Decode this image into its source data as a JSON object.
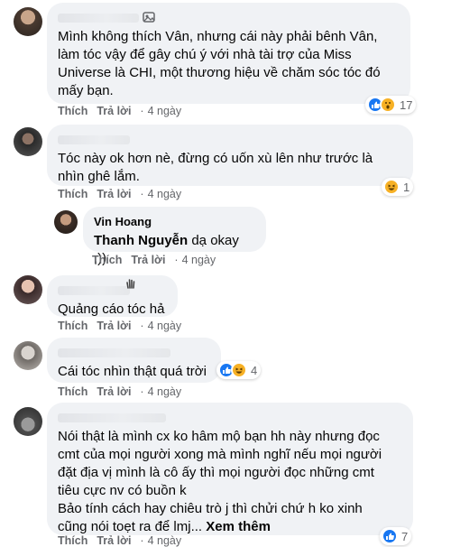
{
  "actions": {
    "like": "Thích",
    "reply": "Trả lời"
  },
  "comments": [
    {
      "text": "Mình không thích Vân, nhưng cái này phải bênh Vân,\nlàm tóc vậy để gây chú ý với nhà tài trợ của Miss\nUniverse là CHI, một thương hiệu về chăm sóc tóc đó\nmấy bạn.",
      "time": "4 ngày",
      "reaction_count": "17",
      "reactions": [
        "like-icon",
        "wow-icon"
      ]
    },
    {
      "text": "Tóc này ok hơn nè, đừng có uốn xù lên như trước là\nnhìn ghê lắm.",
      "time": "4 ngày",
      "reaction_count": "1",
      "reactions": [
        "haha-icon"
      ]
    },
    {
      "name": "Vin Hoang",
      "tag": "Thanh Nguyễn",
      "text": " dạ okay ;))",
      "time": "4 ngày"
    },
    {
      "text": "Quảng cáo tóc hả",
      "time": "4 ngày"
    },
    {
      "text": "Cái tóc nhìn thật quá trời",
      "time": "4 ngày",
      "reaction_count": "4",
      "reactions": [
        "like-icon",
        "haha-icon"
      ]
    },
    {
      "text": "Nói thật là mình cx ko hâm mộ bạn hh này nhưng đọc\ncmt của mọi người xong mà mình nghĩ nếu mọi người\nđặt địa vị mình là cô ấy thì mọi người đọc những cmt\ntiêu cực nv có buồn k\nBảo tính cách hay chiêu trò j thì chửi chứ h ko xinh\ncũng nói toẹt ra để lmj... ",
      "see_more": "Xem thêm",
      "time": "4 ngày",
      "reaction_count": "7",
      "reactions": [
        "like-icon"
      ]
    }
  ],
  "colors": {
    "bubble": "#f0f2f5",
    "meta": "#65676b",
    "like": "#1877f2",
    "wow": "#f7b125"
  }
}
